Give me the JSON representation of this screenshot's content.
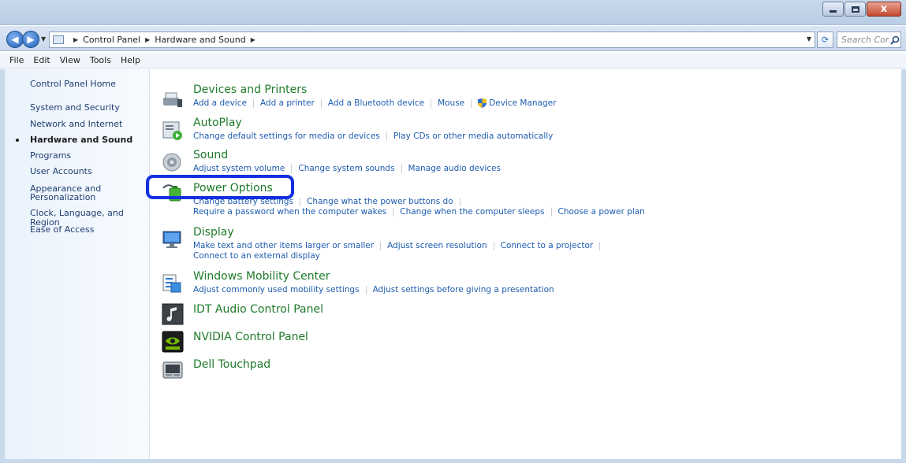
{
  "window": {
    "minimize_icon": "minimize-icon",
    "maximize_icon": "maximize-icon",
    "close_glyph": "x"
  },
  "address_bar": {
    "breadcrumbs": [
      "Control Panel",
      "Hardware and Sound"
    ],
    "search_placeholder": "Search Con..."
  },
  "menu": {
    "items": [
      "File",
      "Edit",
      "View",
      "Tools",
      "Help"
    ]
  },
  "sidebar": {
    "home": "Control Panel Home",
    "items": [
      "System and Security",
      "Network and Internet",
      "Hardware and Sound",
      "Programs",
      "User Accounts",
      "Appearance and",
      "Personalization",
      "Clock, Language, and Region",
      "Ease of Access"
    ],
    "current": "Hardware and Sound"
  },
  "categories": {
    "devices": {
      "title": "Devices and Printers",
      "links": [
        "Add a device",
        "Add a printer",
        "Add a Bluetooth device",
        "Mouse",
        "Device Manager"
      ]
    },
    "autoplay": {
      "title": "AutoPlay",
      "links": [
        "Change default settings for media or devices",
        "Play CDs or other media automatically"
      ]
    },
    "sound": {
      "title": "Sound",
      "links": [
        "Adjust system volume",
        "Change system sounds",
        "Manage audio devices"
      ]
    },
    "power": {
      "title": "Power Options",
      "links": [
        "Change battery settings",
        "Change what the power buttons do"
      ],
      "links2": [
        "Require a password when the computer wakes",
        "Change when the computer sleeps",
        "Choose a power plan"
      ]
    },
    "display": {
      "title": "Display",
      "links": [
        "Make text and other items larger or smaller",
        "Adjust screen resolution",
        "Connect to a projector"
      ],
      "links2": [
        "Connect to an external display"
      ]
    },
    "mobility": {
      "title": "Windows Mobility Center",
      "links": [
        "Adjust commonly used mobility settings",
        "Adjust settings before giving a presentation"
      ]
    },
    "idt": {
      "title": "IDT Audio Control Panel"
    },
    "nvidia": {
      "title": "NVIDIA Control Panel"
    },
    "touchpad": {
      "title": "Dell Touchpad"
    }
  },
  "colors": {
    "title_green": "#1e7b2a",
    "link_blue": "#1e5cb0",
    "highlight": "#1530e0"
  }
}
